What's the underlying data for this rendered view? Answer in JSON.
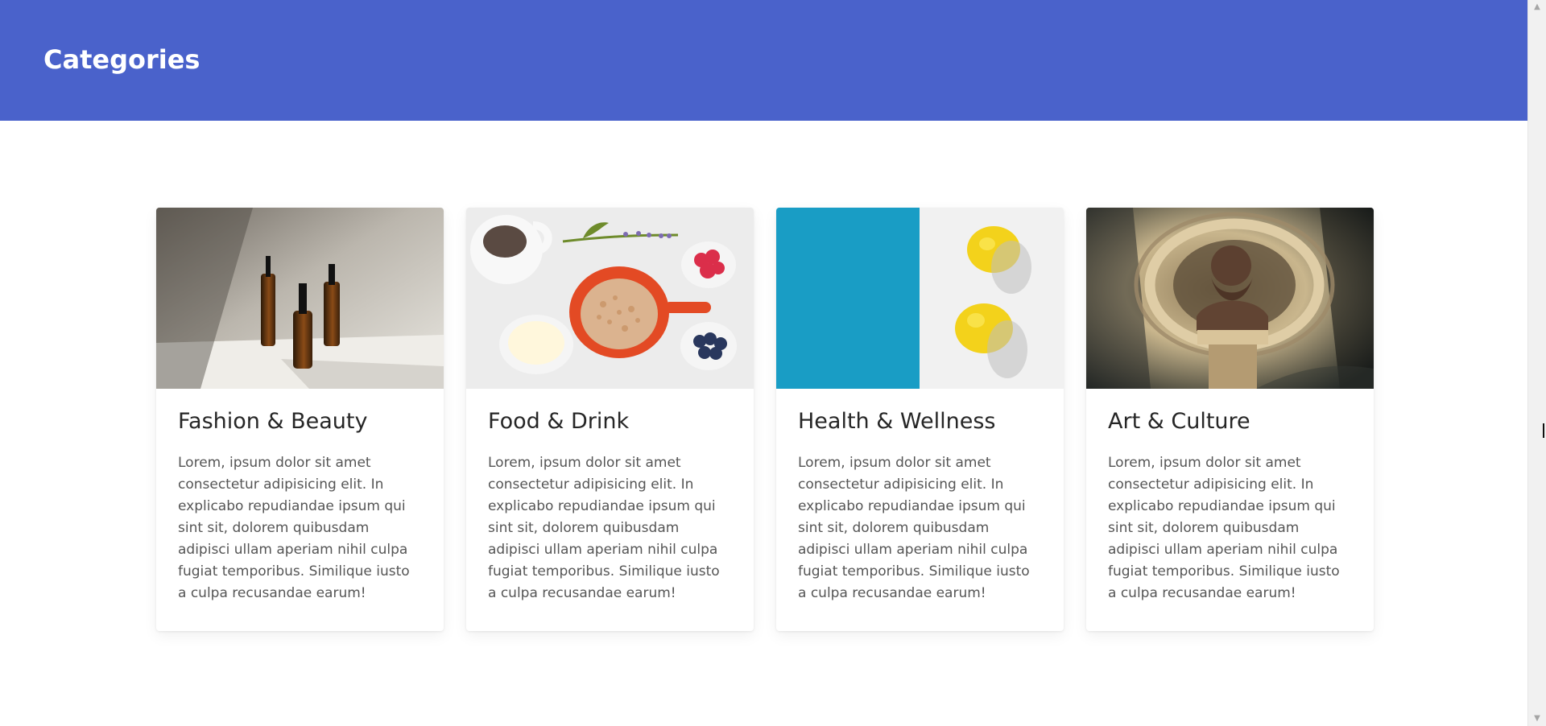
{
  "header": {
    "title": "Categories",
    "background": "#4a62cb"
  },
  "cards": [
    {
      "title": "Fashion & Beauty",
      "text": "Lorem, ipsum dolor sit amet consectetur adipisicing elit. In explicabo repudiandae ipsum qui sint sit, dolorem quibusdam adipisci ullam aperiam nihil culpa fugiat temporibus. Similique iusto a culpa recusandae earum!",
      "image": "serum-bottles-photo"
    },
    {
      "title": "Food & Drink",
      "text": "Lorem, ipsum dolor sit amet consectetur adipisicing elit. In explicabo repudiandae ipsum qui sint sit, dolorem quibusdam adipisci ullam aperiam nihil culpa fugiat temporibus. Similique iusto a culpa recusandae earum!",
      "image": "breakfast-bowls-photo"
    },
    {
      "title": "Health & Wellness",
      "text": "Lorem, ipsum dolor sit amet consectetur adipisicing elit. In explicabo repudiandae ipsum qui sint sit, dolorem quibusdam adipisci ullam aperiam nihil culpa fugiat temporibus. Similique iusto a culpa recusandae earum!",
      "image": "lemons-photo"
    },
    {
      "title": "Art & Culture",
      "text": "Lorem, ipsum dolor sit amet consectetur adipisicing elit. In explicabo repudiandae ipsum qui sint sit, dolorem quibusdam adipisci ullam aperiam nihil culpa fugiat temporibus. Similique iusto a culpa recusandae earum!",
      "image": "statue-bust-photo"
    }
  ],
  "scrollbar": {
    "up_icon": "triangle-up-icon",
    "down_icon": "triangle-down-icon"
  }
}
